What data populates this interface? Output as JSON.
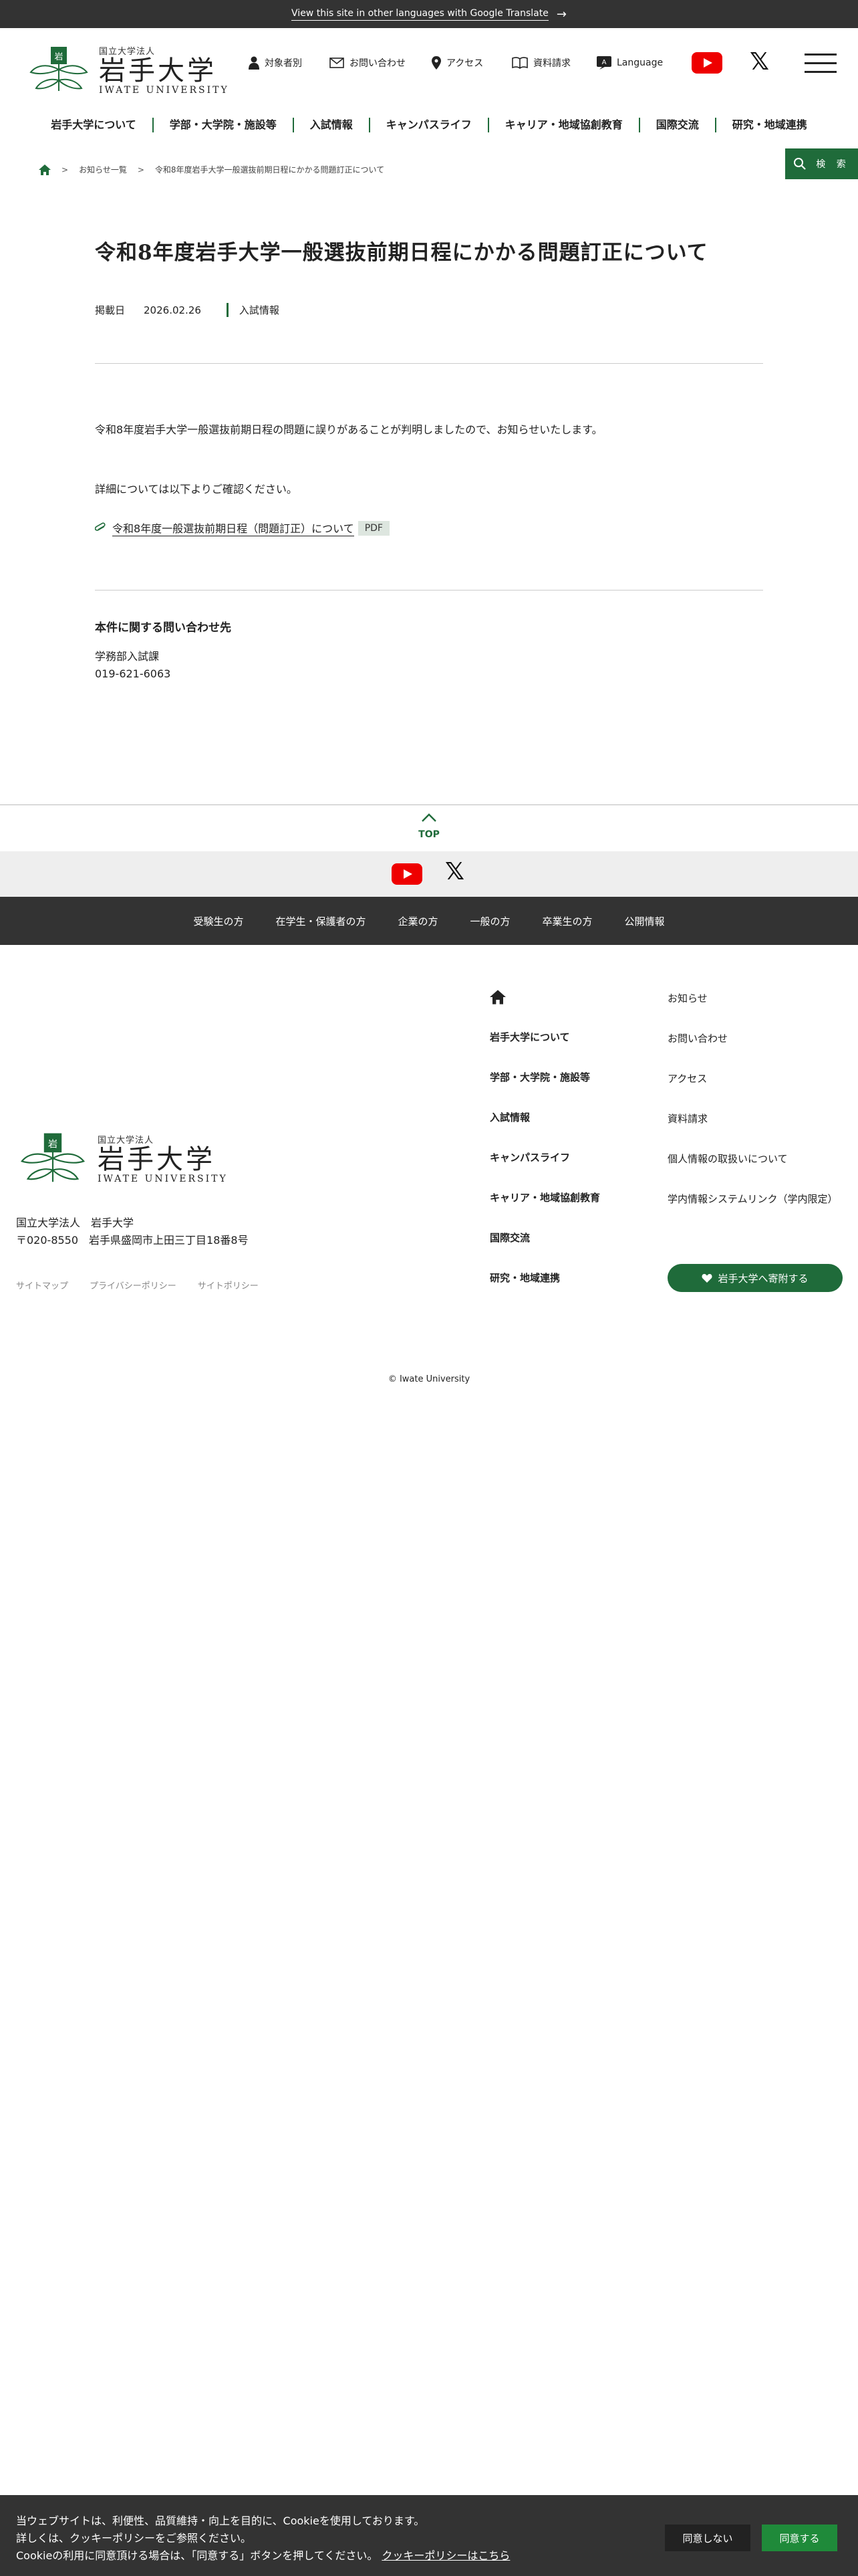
{
  "translate_bar": {
    "text": "View this site in other languages with Google Translate"
  },
  "logo": {
    "small": "国立大学法人",
    "big": "岩手大学",
    "en": "IWATE UNIVERSITY"
  },
  "header_nav": [
    {
      "label": "対象者別",
      "icon": "person-icon"
    },
    {
      "label": "お問い合わせ",
      "icon": "mail-icon"
    },
    {
      "label": "アクセス",
      "icon": "map-pin-icon"
    },
    {
      "label": "資料請求",
      "icon": "book-icon"
    },
    {
      "label": "Language",
      "icon": "language-icon"
    }
  ],
  "global_nav": [
    "岩手大学について",
    "学部・大学院・施設等",
    "入試情報",
    "キャンパスライフ",
    "キャリア・地域協創教育",
    "国際交流",
    "研究・地域連携"
  ],
  "search_label": "検 索",
  "breadcrumb": {
    "level1": "お知らせ一覧",
    "current": "令和8年度岩手大学一般選抜前期日程にかかる問題訂正について"
  },
  "article": {
    "title": "令和8年度岩手大学一般選抜前期日程にかかる問題訂正について",
    "date_label": "掲載日",
    "date": "2026.02.26",
    "category": "入試情報",
    "paragraph1": "令和8年度岩手大学一般選抜前期日程の問題に誤りがあることが判明しましたので、お知らせいたします。",
    "paragraph2": "詳細については以下よりご確認ください。",
    "link_text": "令和8年度一般選抜前期日程（問題訂正）について",
    "link_badge": "PDF",
    "contact_heading": "本件に関する問い合わせ先",
    "contact_dept": "学務部入試課",
    "contact_phone": "019-621-6063"
  },
  "page_top": {
    "label": "TOP"
  },
  "audience_nav": [
    "受験生の方",
    "在学生・保護者の方",
    "企業の方",
    "一般の方",
    "卒業生の方",
    "公開情報"
  ],
  "footer": {
    "address_line1": "国立大学法人　岩手大学",
    "address_line2": "〒020-8550　岩手県盛岡市上田三丁目18番8号",
    "links": [
      "サイトマップ",
      "プライバシーポリシー",
      "サイトポリシー"
    ],
    "col1": [
      "岩手大学について",
      "学部・大学院・施設等",
      "入試情報",
      "キャンパスライフ",
      "キャリア・地域協創教育",
      "国際交流",
      "研究・地域連携"
    ],
    "col2": [
      "お知らせ",
      "お問い合わせ",
      "アクセス",
      "資料請求",
      "個人情報の取扱いについて",
      "学内情報システムリンク（学内限定）"
    ],
    "favorite_button": "岩手大学へ寄附する",
    "copyright": "© Iwate University"
  },
  "cookie": {
    "line1": "当ウェブサイトは、利便性、品質維持・向上を目的に、Cookieを使用しております。",
    "line2": "詳しくは、クッキーポリシーをご参照ください。",
    "line3": "Cookieの利用に同意頂ける場合は、「同意する」ボタンを押してください。",
    "policy_link": "クッキーポリシーはこちら",
    "deny": "同意しない",
    "agree": "同意する"
  },
  "colors": {
    "brand_green": "#1f6b3a",
    "dark_bar": "#333333",
    "youtube_red": "#ee0000"
  }
}
